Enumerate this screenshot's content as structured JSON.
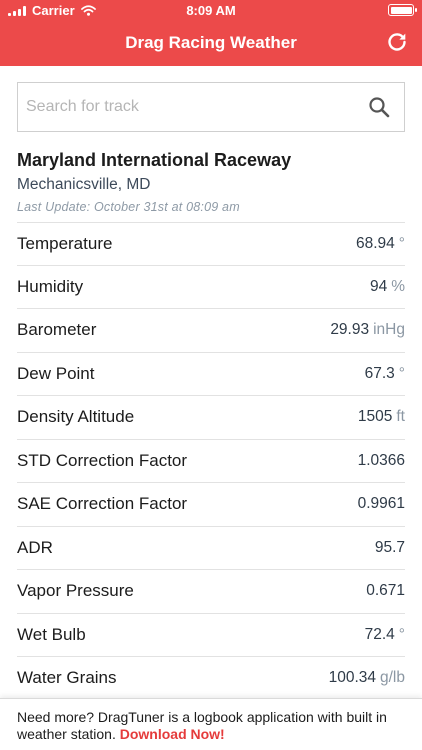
{
  "status_bar": {
    "carrier": "Carrier",
    "time": "8:09 AM",
    "icons": [
      "signal-icon",
      "wifi-icon",
      "battery-icon"
    ]
  },
  "nav": {
    "title": "Drag Racing Weather",
    "refresh_icon": "refresh-icon"
  },
  "colors": {
    "accent": "#ec4a4a",
    "cta": "#e53b3b"
  },
  "search": {
    "placeholder": "Search for track",
    "value": "",
    "icon": "search-icon"
  },
  "track": {
    "name": "Maryland International Raceway",
    "location": "Mechanicsville, MD",
    "last_update": "Last Update: October 31st at 08:09 am"
  },
  "weather": [
    {
      "label": "Temperature",
      "value": "68.94",
      "unit": "°"
    },
    {
      "label": "Humidity",
      "value": "94",
      "unit": "%"
    },
    {
      "label": "Barometer",
      "value": "29.93",
      "unit": "inHg"
    },
    {
      "label": "Dew Point",
      "value": "67.3",
      "unit": "°"
    },
    {
      "label": "Density Altitude",
      "value": "1505",
      "unit": "ft"
    },
    {
      "label": "STD Correction Factor",
      "value": "1.0366",
      "unit": ""
    },
    {
      "label": "SAE Correction Factor",
      "value": "0.9961",
      "unit": ""
    },
    {
      "label": "ADR",
      "value": "95.7",
      "unit": ""
    },
    {
      "label": "Vapor Pressure",
      "value": "0.671",
      "unit": ""
    },
    {
      "label": "Wet Bulb",
      "value": "72.4",
      "unit": "°"
    },
    {
      "label": "Water Grains",
      "value": "100.34",
      "unit": "g/lb"
    }
  ],
  "footer": {
    "text": "Need more? DragTuner is a logbook application with built in weather station.",
    "cta": "Download Now!"
  }
}
